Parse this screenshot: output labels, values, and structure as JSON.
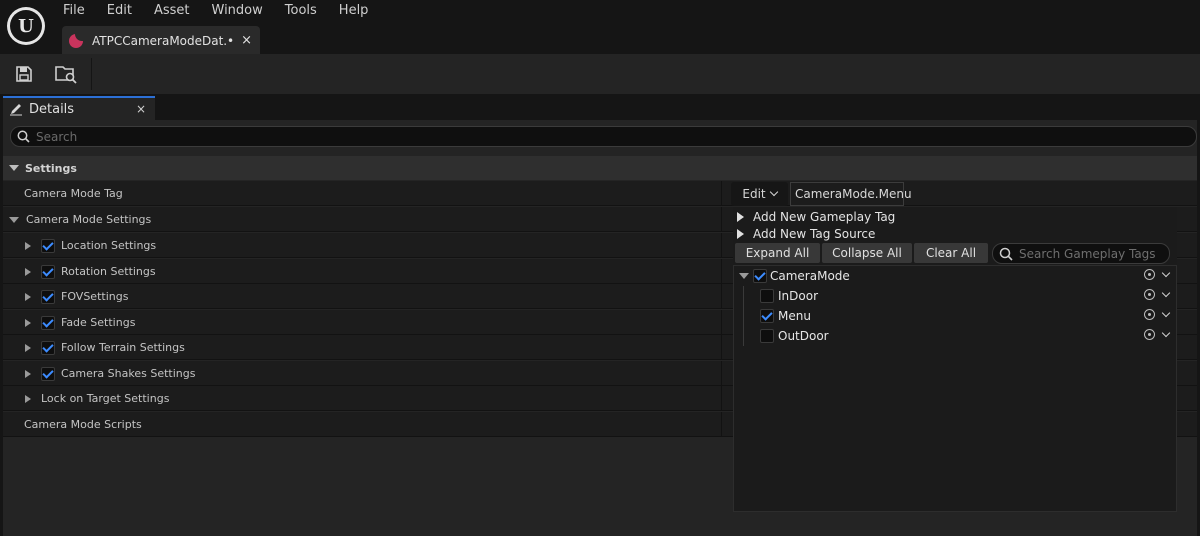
{
  "app": {
    "logo_letter": "U",
    "menu": [
      "File",
      "Edit",
      "Asset",
      "Window",
      "Tools",
      "Help"
    ]
  },
  "document_tab": {
    "label": "ATPCCameraModeDat...",
    "modified_marker": "•",
    "close": "×"
  },
  "toolbar": {
    "save_icon": "floppy-disk-icon",
    "browse_icon": "folder-search-icon"
  },
  "details_tab": {
    "label": "Details",
    "close": "×"
  },
  "search": {
    "placeholder": "Search"
  },
  "category": {
    "label": "Settings"
  },
  "rows": {
    "camera_mode_tag": "Camera Mode Tag",
    "camera_mode_settings": "Camera Mode Settings",
    "location": "Location Settings",
    "rotation": "Rotation Settings",
    "fov": "FOVSettings",
    "fade": "Fade Settings",
    "follow_terrain": "Follow Terrain Settings",
    "shakes": "Camera Shakes Settings",
    "lock_on": "Lock on Target Settings",
    "scripts": "Camera Mode Scripts"
  },
  "tag_field": {
    "edit_label": "Edit",
    "value": "CameraMode.Menu"
  },
  "tag_picker": {
    "add_tag": "Add New Gameplay Tag",
    "add_source": "Add New Tag Source",
    "expand_all": "Expand All",
    "collapse_all": "Collapse All",
    "clear_all": "Clear All",
    "search_placeholder": "Search Gameplay Tags",
    "tree": {
      "root": "CameraMode",
      "children": [
        "InDoor",
        "Menu",
        "OutDoor"
      ]
    }
  },
  "colors": {
    "accent": "#3d8cff",
    "tab_accent": "#2c70d6",
    "asset_icon": "#c9345d"
  }
}
